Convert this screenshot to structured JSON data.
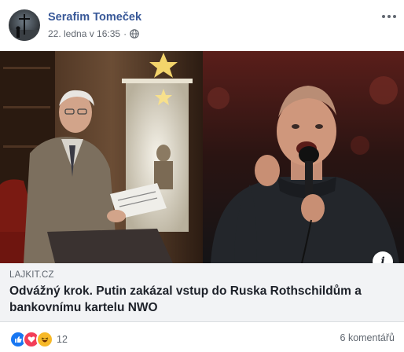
{
  "header": {
    "author": "Serafim Tomeček",
    "timestamp": "22. ledna v 16:35",
    "privacy_icon": "globe-icon",
    "more_icon": "more-options-icon"
  },
  "link": {
    "domain": "LAJKIT.CZ",
    "headline": "Odvážný krok. Putin zakázal vstup do Ruska Rothschildům a bankovnímu kartelu NWO",
    "info_icon": "info-icon"
  },
  "footer": {
    "reaction_icons": [
      "like-icon",
      "love-icon",
      "haha-icon"
    ],
    "reaction_count": "12",
    "comments": "6 komentářů"
  },
  "colors": {
    "author_link": "#385898",
    "meta_text": "#616770",
    "link_box_bg": "#f2f3f5",
    "like": "#1877f2",
    "love": "#f33e58",
    "haha": "#f7b928"
  }
}
